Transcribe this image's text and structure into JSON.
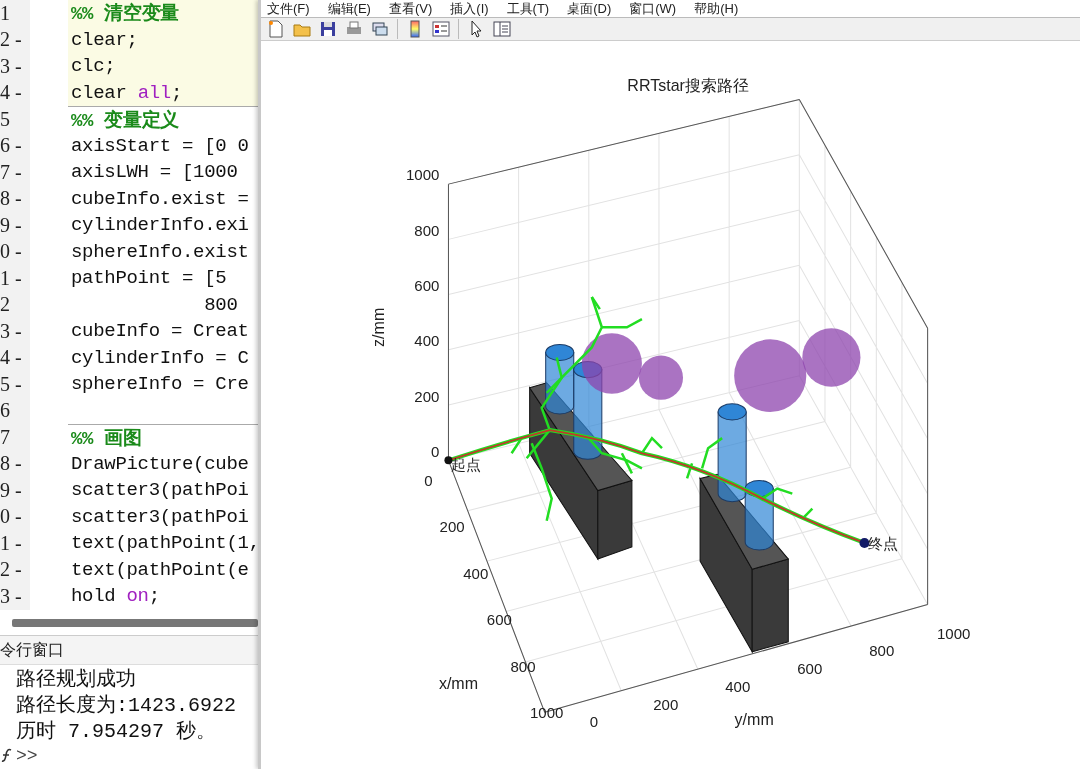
{
  "editor": {
    "lines": [
      {
        "gutter": "1",
        "highlighted": true,
        "cell_start": false,
        "segments": [
          {
            "kind": "comment",
            "text": "%% 清空变量"
          }
        ]
      },
      {
        "gutter": "2 -",
        "highlighted": true,
        "cell_start": false,
        "segments": [
          {
            "kind": "code",
            "text": "clear;"
          }
        ]
      },
      {
        "gutter": "3 -",
        "highlighted": true,
        "cell_start": false,
        "segments": [
          {
            "kind": "code",
            "text": "clc;"
          }
        ]
      },
      {
        "gutter": "4 -",
        "highlighted": true,
        "cell_start": false,
        "segments": [
          {
            "kind": "code",
            "text": "clear "
          },
          {
            "kind": "keyword",
            "text": "all"
          },
          {
            "kind": "code",
            "text": ";"
          }
        ]
      },
      {
        "gutter": "5",
        "highlighted": false,
        "cell_start": true,
        "segments": [
          {
            "kind": "comment",
            "text": "%% 变量定义"
          }
        ]
      },
      {
        "gutter": "6 -",
        "highlighted": false,
        "cell_start": false,
        "segments": [
          {
            "kind": "code",
            "text": "axisStart = [0 0"
          }
        ]
      },
      {
        "gutter": "7 -",
        "highlighted": false,
        "cell_start": false,
        "segments": [
          {
            "kind": "code",
            "text": "axisLWH = [1000"
          }
        ]
      },
      {
        "gutter": "8 -",
        "highlighted": false,
        "cell_start": false,
        "segments": [
          {
            "kind": "code",
            "text": "cubeInfo.exist ="
          }
        ]
      },
      {
        "gutter": "9 -",
        "highlighted": false,
        "cell_start": false,
        "segments": [
          {
            "kind": "code",
            "text": "cylinderInfo.exi"
          }
        ]
      },
      {
        "gutter": "0 -",
        "highlighted": false,
        "cell_start": false,
        "segments": [
          {
            "kind": "code",
            "text": "sphereInfo.exist"
          }
        ]
      },
      {
        "gutter": "1 -",
        "highlighted": false,
        "cell_start": false,
        "segments": [
          {
            "kind": "code",
            "text": "pathPoint = [5"
          }
        ]
      },
      {
        "gutter": "2",
        "highlighted": false,
        "cell_start": false,
        "segments": [
          {
            "kind": "code",
            "text": "            800"
          }
        ]
      },
      {
        "gutter": "3 -",
        "highlighted": false,
        "cell_start": false,
        "segments": [
          {
            "kind": "code",
            "text": "cubeInfo = Creat"
          }
        ]
      },
      {
        "gutter": "4 -",
        "highlighted": false,
        "cell_start": false,
        "segments": [
          {
            "kind": "code",
            "text": "cylinderInfo = C"
          }
        ]
      },
      {
        "gutter": "5 -",
        "highlighted": false,
        "cell_start": false,
        "segments": [
          {
            "kind": "code",
            "text": "sphereInfo = Cre"
          }
        ]
      },
      {
        "gutter": "6",
        "highlighted": false,
        "cell_start": false
      },
      {
        "gutter": "7",
        "highlighted": false,
        "cell_start": true,
        "segments": [
          {
            "kind": "comment",
            "text": "%% 画图"
          }
        ]
      },
      {
        "gutter": "8 -",
        "highlighted": false,
        "cell_start": false,
        "segments": [
          {
            "kind": "code",
            "text": "DrawPicture(cube"
          }
        ]
      },
      {
        "gutter": "9 -",
        "highlighted": false,
        "cell_start": false,
        "segments": [
          {
            "kind": "code",
            "text": "scatter3(pathPoi"
          }
        ]
      },
      {
        "gutter": "0 -",
        "highlighted": false,
        "cell_start": false,
        "segments": [
          {
            "kind": "code",
            "text": "scatter3(pathPoi"
          }
        ]
      },
      {
        "gutter": "1 -",
        "highlighted": false,
        "cell_start": false,
        "segments": [
          {
            "kind": "code",
            "text": "text(pathPoint(1,"
          }
        ]
      },
      {
        "gutter": "2 -",
        "highlighted": false,
        "cell_start": false,
        "segments": [
          {
            "kind": "code",
            "text": "text(pathPoint(e"
          }
        ]
      },
      {
        "gutter": "3 -",
        "highlighted": false,
        "cell_start": false,
        "segments": [
          {
            "kind": "code",
            "text": "hold "
          },
          {
            "kind": "keyword",
            "text": "on"
          },
          {
            "kind": "code",
            "text": ";"
          }
        ]
      }
    ]
  },
  "command_window": {
    "title": "令行窗口",
    "output": [
      "路径规划成功",
      "路径长度为:1423.6922",
      "历时 7.954297 秒。"
    ],
    "prompt": ">>"
  },
  "figure": {
    "menu": [
      "文件(F)",
      "编辑(E)",
      "查看(V)",
      "插入(I)",
      "工具(T)",
      "桌面(D)",
      "窗口(W)",
      "帮助(H)"
    ],
    "toolbar": [
      {
        "kind": "new"
      },
      {
        "kind": "open"
      },
      {
        "kind": "save"
      },
      {
        "kind": "print"
      },
      {
        "kind": "link"
      },
      {
        "kind": "separator"
      },
      {
        "kind": "colorbar"
      },
      {
        "kind": "legend"
      },
      {
        "kind": "separator"
      },
      {
        "kind": "pointer"
      },
      {
        "kind": "panel"
      }
    ],
    "plot": {
      "title": "RRTstar搜索路径",
      "zlabel": "z/mm",
      "xlabel": "x/mm",
      "ylabel": "y/mm",
      "zticks": [
        "1000",
        "800",
        "600",
        "400",
        "200",
        "0"
      ],
      "xticks": [
        "0",
        "200",
        "400",
        "600",
        "800",
        "1000"
      ],
      "yticks": [
        "0",
        "200",
        "400",
        "600",
        "800",
        "1000"
      ],
      "start_label": "起点",
      "end_label": "终点"
    }
  }
}
